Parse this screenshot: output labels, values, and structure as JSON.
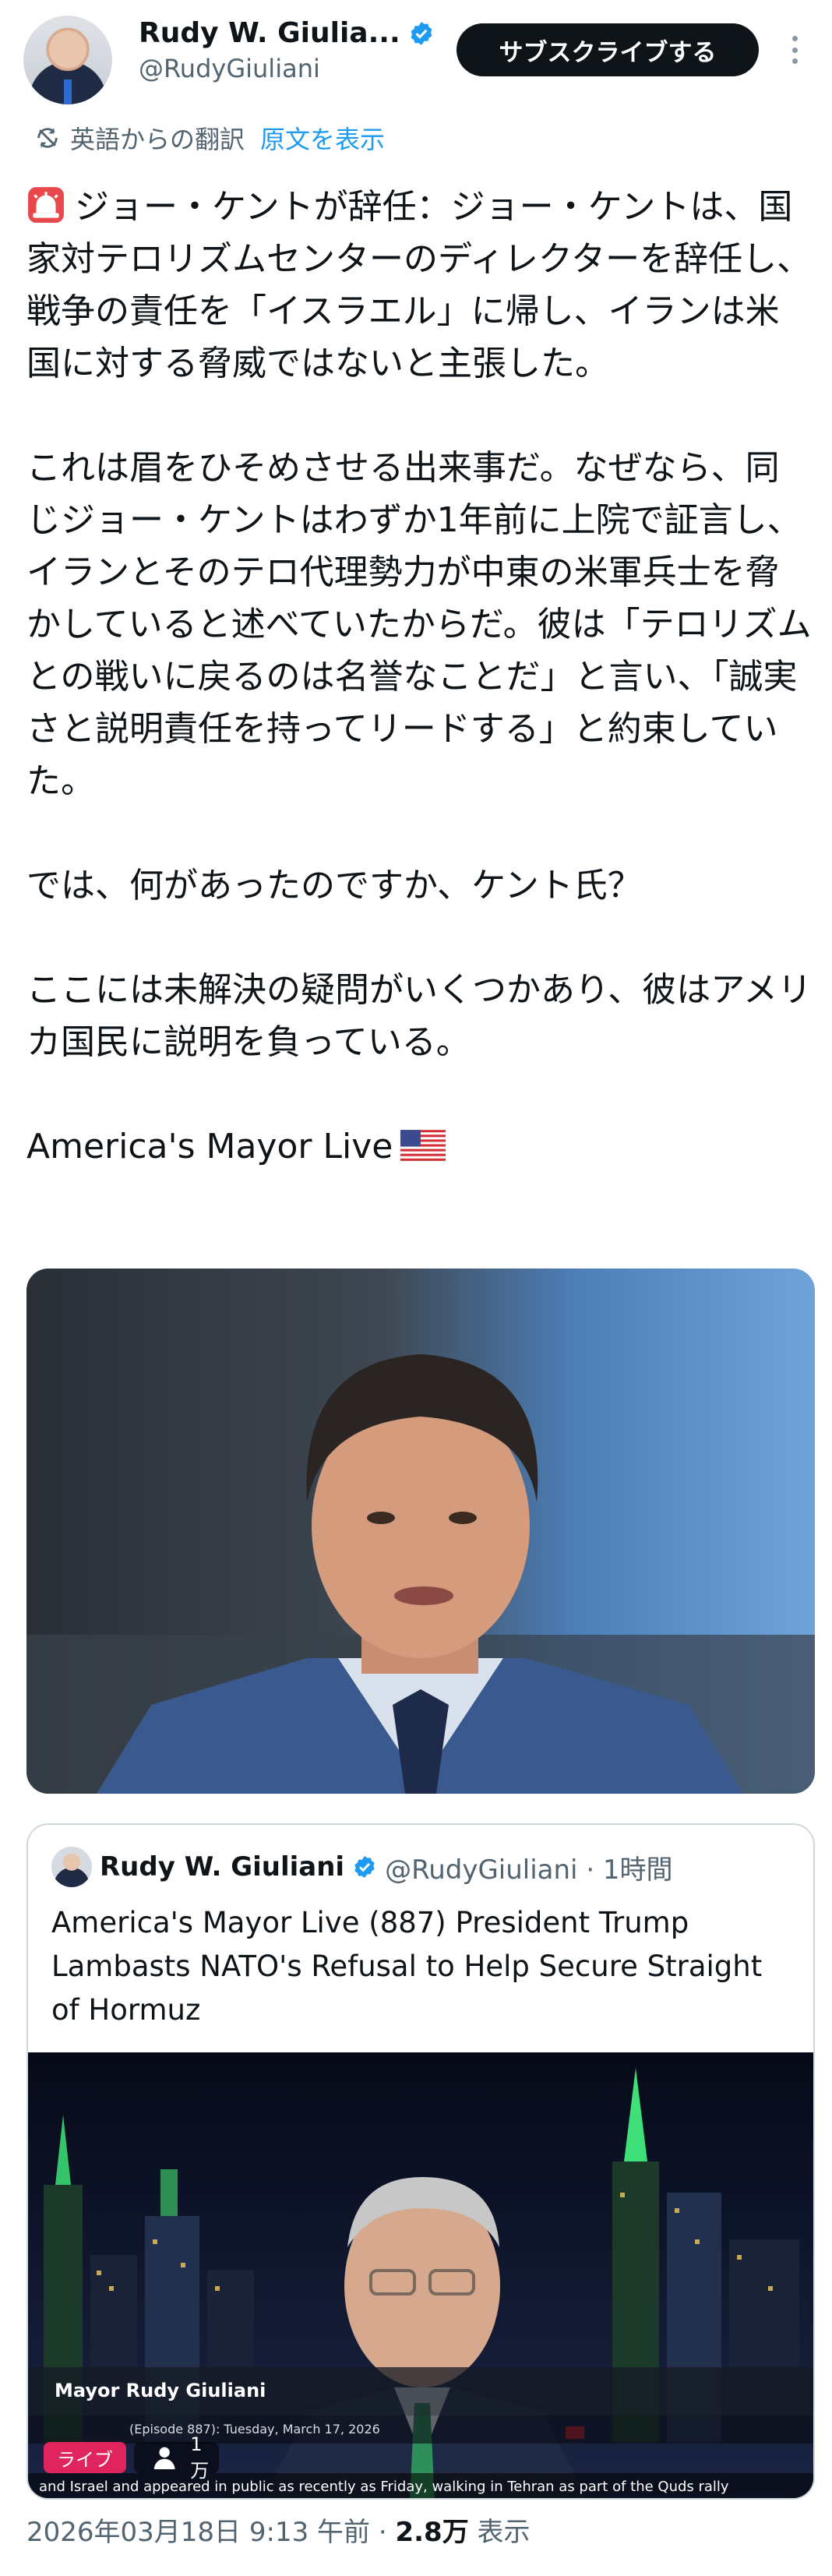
{
  "author": {
    "display_name": "Rudy W. Giulia...",
    "handle": "@RudyGiuliani",
    "subscribe_label": "サブスクライブする"
  },
  "translation": {
    "label": "英語からの翻訳",
    "show_original": "原文を表示"
  },
  "tweet": {
    "paragraphs": [
      "ジョー・ケントが辞任：ジョー・ケントは、国家対テロリズムセンターのディレクターを辞任し、戦争の責任を「イスラエル」に帰し、イランは米国に対する脅威ではないと主張した。",
      "これは眉をひそめさせる出来事だ。なぜなら、同じジョー・ケントはわずか1年前に上院で証言し、イランとそのテロ代理勢力が中東の米軍兵士を脅かしていると述べていたからだ。彼は「テロリズムとの戦いに戻るのは名誉なことだ」と言い、「誠実さと説明責任を持ってリードする」と約束していた。",
      "では、何があったのですか、ケント氏？",
      "ここには未解決の疑問がいくつかあり、彼はアメリカ国民に説明を負っている。",
      "America's Mayor Live"
    ]
  },
  "quote": {
    "name": "Rudy W. Giuliani",
    "handle_time": "@RudyGiuliani · 1時間",
    "text": "America's Mayor Live (887) President Trump Lambasts NATO's Refusal to Help Secure Straight of Hormuz",
    "lower_third": "Mayor Rudy Giuliani",
    "episode_line": "(Episode 887): Tuesday, March 17, 2026",
    "ticker": "and Israel and appeared in public as recently as Friday, walking in Tehran as part of the Quds rally",
    "live_label": "ライブ",
    "viewers": "1万"
  },
  "footer": {
    "timestamp": "2026年03月18日 9:13 午前",
    "separator": " · ",
    "views_count": "2.8万",
    "views_label": " 表示"
  },
  "colors": {
    "accent": "#1d9bf0",
    "live": "#e0245e",
    "text": "#0f1419",
    "muted": "#536471"
  }
}
